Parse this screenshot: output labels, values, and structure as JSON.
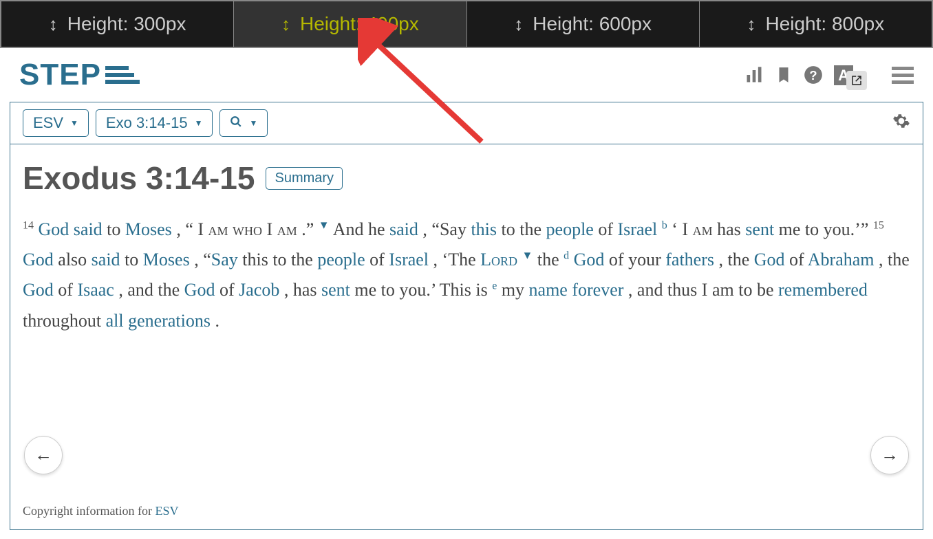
{
  "tabs": [
    {
      "label": "Height: 300px"
    },
    {
      "label": "Height: 400px"
    },
    {
      "label": "Height: 600px"
    },
    {
      "label": "Height: 800px"
    }
  ],
  "logo_text": "STEP",
  "toolbar": {
    "version": "ESV",
    "passage": "Exo 3:14-15"
  },
  "header": {
    "title": "Exodus 3:14-15",
    "summary_label": "Summary"
  },
  "verses": {
    "v14_num": "14",
    "v14_god": "God",
    "v14_said": "said",
    "v14_to": " to ",
    "v14_moses": "Moses",
    "v14_q1a": ", “ I ",
    "v14_am1": "am",
    "v14_who": " who ",
    "v14_q1b": "I ",
    "v14_am2": "am",
    "v14_period": ".” ",
    "v14_andhe": " And he ",
    "v14_said2": "said",
    "v14_say": ", “Say ",
    "v14_this": "this",
    "v14_tothe": " to the ",
    "v14_people": "people",
    "v14_of": " of ",
    "v14_israel": "Israel",
    "v14_noteb": " b",
    "v14_iam3a": " ‘ I ",
    "v14_am3": "am",
    "v14_has": " has ",
    "v14_sent": "sent",
    "v14_metoyou": " me to you.’” ",
    "v15_num": "15",
    "v15_god": "God",
    "v15_also": " also ",
    "v15_said": "said",
    "v15_to": " to ",
    "v15_moses": "Moses",
    "v15_say": ", “",
    "v15_saylink": "Say",
    "v15_thistothe": " this to the ",
    "v15_people": "people",
    "v15_of": " of ",
    "v15_israel": "Israel",
    "v15_the": ", ‘The  ",
    "v15_lord": "Lord",
    "v15_thed": " the ",
    "v15_noted": "d",
    "v15_god2": " God",
    "v15_ofyour": " of your ",
    "v15_fathers": "fathers",
    "v15_comma": ", the ",
    "v15_god3": "God",
    "v15_of2": " of ",
    "v15_abraham": "Abraham",
    "v15_comma2": ", the ",
    "v15_god4": "God",
    "v15_of3": " of ",
    "v15_isaac": "Isaac",
    "v15_comma3": ", and the ",
    "v15_god5": "God",
    "v15_of4": " of ",
    "v15_jacob": "Jacob",
    "v15_hassent": ", has ",
    "v15_sent": "sent",
    "v15_metoyou2": " me to you.’ This is ",
    "v15_notee": "e",
    "v15_my": " my ",
    "v15_name": "name",
    "v15_sp": " ",
    "v15_forever": "forever",
    "v15_andthus": ", and thus I am to be ",
    "v15_remembered": "remembered",
    "v15_throughout": " throughout ",
    "v15_allgen": "all generations",
    "v15_period": "."
  },
  "copyright": {
    "prefix": "Copyright information for ",
    "link": "ESV"
  }
}
